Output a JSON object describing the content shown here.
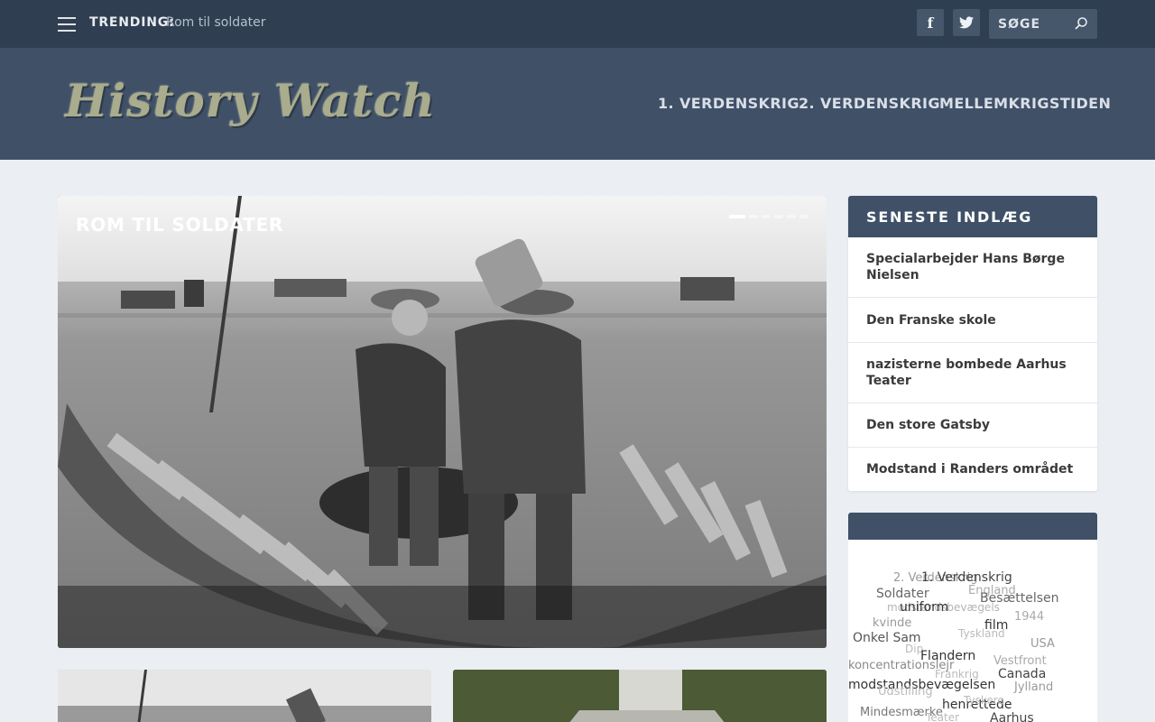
{
  "topbar": {
    "trending_label": "TRENDING:",
    "trending_link": "Rom til soldater",
    "search_placeholder": "SØGE"
  },
  "header": {
    "logo_text": "History Watch",
    "nav": [
      "1. VERDENSKRIG",
      "2. VERDENSKRIG",
      "MELLEMKRIGSTIDEN"
    ]
  },
  "slider": {
    "caption": "ROM TIL SOLDATER",
    "dot_count": 6,
    "active_dot": 0
  },
  "sidebar": {
    "recent_title": "SENESTE INDLÆG",
    "recent_posts": [
      "Specialarbejder Hans Børge Nielsen",
      "Den Franske skole",
      "nazisterne bombede Aarhus Teater",
      "Den store Gatsby",
      "Modstand i Randers området"
    ],
    "tags": [
      "2. Verdenskrig",
      "1. Verdenskrig",
      "England",
      "Soldater",
      "Besættelsen",
      "modstandsbevægels",
      "uniform",
      "1944",
      "kvinde",
      "film",
      "Tyskland",
      "Onkel Sam",
      "USA",
      "Dip",
      "Flandern",
      "Vestfront",
      "koncentrationslejr",
      "Frankrig",
      "Canada",
      "modstandsbevægelsen",
      "Jylland",
      "Udstilling",
      "henrettede",
      "Tyskere",
      "Mindesmærke",
      "Teater",
      "Aarhus"
    ]
  },
  "colors": {
    "topbar": "#2f3e51",
    "header": "#3f5067",
    "page_bg": "#ebeef3",
    "logo": "#a9ac8d"
  }
}
